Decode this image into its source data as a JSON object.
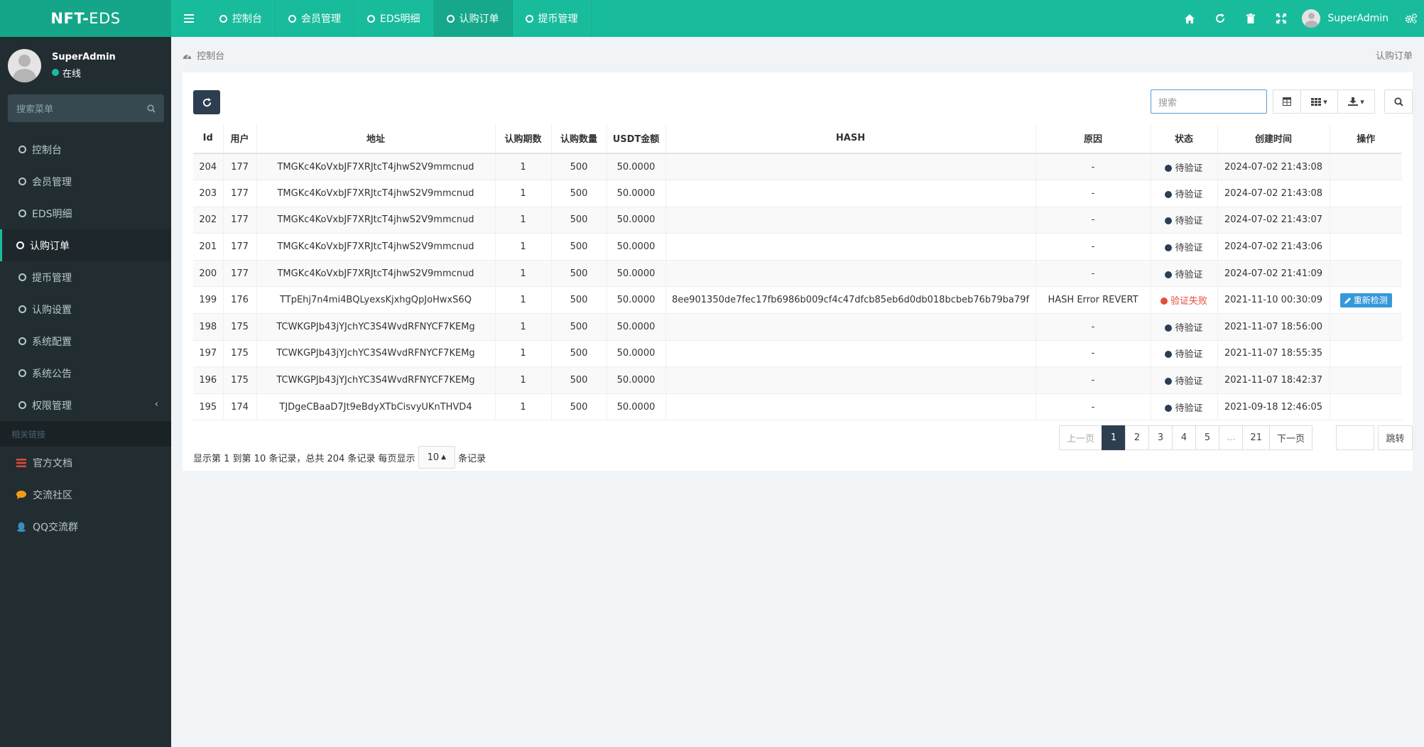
{
  "app": {
    "logo_bold": "NFT-",
    "logo_thin": "EDS"
  },
  "topnav": {
    "tabs": [
      {
        "label": "控制台"
      },
      {
        "label": "会员管理"
      },
      {
        "label": "EDS明细"
      },
      {
        "label": "认购订单",
        "active": true
      },
      {
        "label": "提币管理"
      }
    ],
    "username": "SuperAdmin"
  },
  "sidebar": {
    "username": "SuperAdmin",
    "status": "在线",
    "search_placeholder": "搜索菜单",
    "items": [
      {
        "label": "控制台"
      },
      {
        "label": "会员管理"
      },
      {
        "label": "EDS明细"
      },
      {
        "label": "认购订单",
        "active": true
      },
      {
        "label": "提币管理"
      },
      {
        "label": "认购设置"
      },
      {
        "label": "系统配置"
      },
      {
        "label": "系统公告"
      },
      {
        "label": "权限管理"
      }
    ],
    "links_header": "相关链接",
    "links": [
      {
        "label": "官方文档",
        "icon": "list-icon",
        "color": "#dd4b39"
      },
      {
        "label": "交流社区",
        "icon": "comment-icon",
        "color": "#f39c12"
      },
      {
        "label": "QQ交流群",
        "icon": "qq-icon",
        "color": "#3c8dbc"
      }
    ]
  },
  "breadcrumb": {
    "home": "控制台",
    "current": "认购订单"
  },
  "toolbar": {
    "search_placeholder": "搜索"
  },
  "table": {
    "columns": [
      "Id",
      "用户",
      "地址",
      "认购期数",
      "认购数量",
      "USDT金额",
      "HASH",
      "原因",
      "状态",
      "创建时间",
      "操作"
    ],
    "rows": [
      {
        "id": "204",
        "user": "177",
        "address": "TMGKc4KoVxbJF7XRJtcT4jhwS2V9mmcnud",
        "period": "1",
        "qty": "500",
        "usdt": "50.0000",
        "hash": "",
        "reason": "-",
        "status": "待验证",
        "status_type": "wait",
        "created": "2024-07-02 21:43:08",
        "action": ""
      },
      {
        "id": "203",
        "user": "177",
        "address": "TMGKc4KoVxbJF7XRJtcT4jhwS2V9mmcnud",
        "period": "1",
        "qty": "500",
        "usdt": "50.0000",
        "hash": "",
        "reason": "-",
        "status": "待验证",
        "status_type": "wait",
        "created": "2024-07-02 21:43:08",
        "action": ""
      },
      {
        "id": "202",
        "user": "177",
        "address": "TMGKc4KoVxbJF7XRJtcT4jhwS2V9mmcnud",
        "period": "1",
        "qty": "500",
        "usdt": "50.0000",
        "hash": "",
        "reason": "-",
        "status": "待验证",
        "status_type": "wait",
        "created": "2024-07-02 21:43:07",
        "action": ""
      },
      {
        "id": "201",
        "user": "177",
        "address": "TMGKc4KoVxbJF7XRJtcT4jhwS2V9mmcnud",
        "period": "1",
        "qty": "500",
        "usdt": "50.0000",
        "hash": "",
        "reason": "-",
        "status": "待验证",
        "status_type": "wait",
        "created": "2024-07-02 21:43:06",
        "action": ""
      },
      {
        "id": "200",
        "user": "177",
        "address": "TMGKc4KoVxbJF7XRJtcT4jhwS2V9mmcnud",
        "period": "1",
        "qty": "500",
        "usdt": "50.0000",
        "hash": "",
        "reason": "-",
        "status": "待验证",
        "status_type": "wait",
        "created": "2024-07-02 21:41:09",
        "action": ""
      },
      {
        "id": "199",
        "user": "176",
        "address": "TTpEhj7n4mi4BQLyexsKjxhgQpJoHwxS6Q",
        "period": "1",
        "qty": "500",
        "usdt": "50.0000",
        "hash": "8ee901350de7fec17fb6986b009cf4c47dfcb85eb6d0db018bcbeb76b79ba79f",
        "reason": "HASH Error REVERT",
        "status": "验证失败",
        "status_type": "fail",
        "created": "2021-11-10 00:30:09",
        "action": "重新检测"
      },
      {
        "id": "198",
        "user": "175",
        "address": "TCWKGPJb43jYJchYC3S4WvdRFNYCF7KEMg",
        "period": "1",
        "qty": "500",
        "usdt": "50.0000",
        "hash": "",
        "reason": "-",
        "status": "待验证",
        "status_type": "wait",
        "created": "2021-11-07 18:56:00",
        "action": ""
      },
      {
        "id": "197",
        "user": "175",
        "address": "TCWKGPJb43jYJchYC3S4WvdRFNYCF7KEMg",
        "period": "1",
        "qty": "500",
        "usdt": "50.0000",
        "hash": "",
        "reason": "-",
        "status": "待验证",
        "status_type": "wait",
        "created": "2021-11-07 18:55:35",
        "action": ""
      },
      {
        "id": "196",
        "user": "175",
        "address": "TCWKGPJb43jYJchYC3S4WvdRFNYCF7KEMg",
        "period": "1",
        "qty": "500",
        "usdt": "50.0000",
        "hash": "",
        "reason": "-",
        "status": "待验证",
        "status_type": "wait",
        "created": "2021-11-07 18:42:37",
        "action": ""
      },
      {
        "id": "195",
        "user": "174",
        "address": "TJDgeCBaaD7Jt9eBdyXTbCisvyUKnTHVD4",
        "period": "1",
        "qty": "500",
        "usdt": "50.0000",
        "hash": "",
        "reason": "-",
        "status": "待验证",
        "status_type": "wait",
        "created": "2021-09-18 12:46:05",
        "action": ""
      }
    ]
  },
  "pagination": {
    "info_before": "显示第 1 到第 10 条记录，总共 204 条记录 每页显示",
    "page_size": "10",
    "info_after": "条记录",
    "prev": "上一页",
    "pages": [
      "1",
      "2",
      "3",
      "4",
      "5",
      "...",
      "21"
    ],
    "current": "1",
    "next": "下一页",
    "jump": "跳转"
  },
  "colors": {
    "brand": "#18bc9c",
    "sidebar_bg": "#222d32",
    "dark_button": "#2c3e50",
    "fail": "#e74c3c",
    "wait": "#2c3e50",
    "action_button": "#3498db"
  }
}
